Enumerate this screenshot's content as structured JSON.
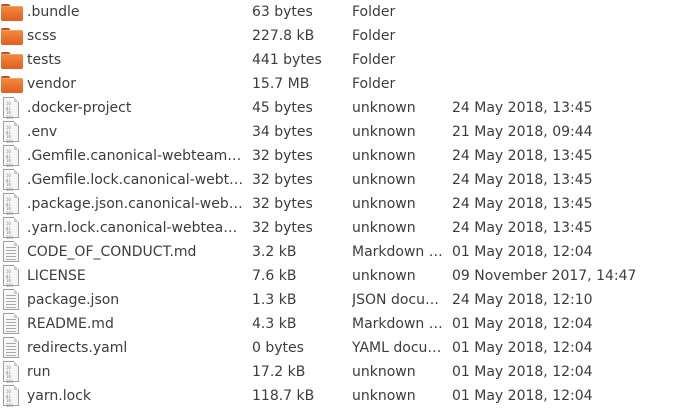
{
  "files": [
    {
      "name": ".bundle",
      "size": "63 bytes",
      "type": "Folder",
      "modified": "",
      "icon": "folder-icon"
    },
    {
      "name": "scss",
      "size": "227.8 kB",
      "type": "Folder",
      "modified": "",
      "icon": "folder-icon"
    },
    {
      "name": "tests",
      "size": "441 bytes",
      "type": "Folder",
      "modified": "",
      "icon": "folder-icon"
    },
    {
      "name": "vendor",
      "size": "15.7 MB",
      "type": "Folder",
      "modified": "",
      "icon": "folder-icon"
    },
    {
      "name": ".docker-project",
      "size": "45 bytes",
      "type": "unknown",
      "modified": "24 May 2018, 13:45",
      "icon": "binary-file-icon"
    },
    {
      "name": ".env",
      "size": "34 bytes",
      "type": "unknown",
      "modified": "21 May 2018, 09:44",
      "icon": "binary-file-icon"
    },
    {
      "name": ".Gemfile.canonical-webteam-…",
      "size": "32 bytes",
      "type": "unknown",
      "modified": "24 May 2018, 13:45",
      "icon": "binary-file-icon"
    },
    {
      "name": ".Gemfile.lock.canonical-webte…",
      "size": "32 bytes",
      "type": "unknown",
      "modified": "24 May 2018, 13:45",
      "icon": "binary-file-icon"
    },
    {
      "name": ".package.json.canonical-webt…",
      "size": "32 bytes",
      "type": "unknown",
      "modified": "24 May 2018, 13:45",
      "icon": "binary-file-icon"
    },
    {
      "name": ".yarn.lock.canonical-webteam…",
      "size": "32 bytes",
      "type": "unknown",
      "modified": "24 May 2018, 13:45",
      "icon": "binary-file-icon"
    },
    {
      "name": "CODE_OF_CONDUCT.md",
      "size": "3.2 kB",
      "type": "Markdown …",
      "modified": "01 May 2018, 12:04",
      "icon": "text-file-icon"
    },
    {
      "name": "LICENSE",
      "size": "7.6 kB",
      "type": "unknown",
      "modified": "09 November 2017, 14:47",
      "icon": "binary-file-icon"
    },
    {
      "name": "package.json",
      "size": "1.3 kB",
      "type": "JSON docu…",
      "modified": "24 May 2018, 12:10",
      "icon": "text-file-icon"
    },
    {
      "name": "README.md",
      "size": "4.3 kB",
      "type": "Markdown …",
      "modified": "01 May 2018, 12:04",
      "icon": "text-file-icon"
    },
    {
      "name": "redirects.yaml",
      "size": "0 bytes",
      "type": "YAML docu…",
      "modified": "01 May 2018, 12:04",
      "icon": "text-file-icon"
    },
    {
      "name": "run",
      "size": "17.2 kB",
      "type": "unknown",
      "modified": "01 May 2018, 12:04",
      "icon": "binary-file-icon"
    },
    {
      "name": "yarn.lock",
      "size": "118.7 kB",
      "type": "unknown",
      "modified": "01 May 2018, 12:04",
      "icon": "binary-file-icon"
    }
  ]
}
